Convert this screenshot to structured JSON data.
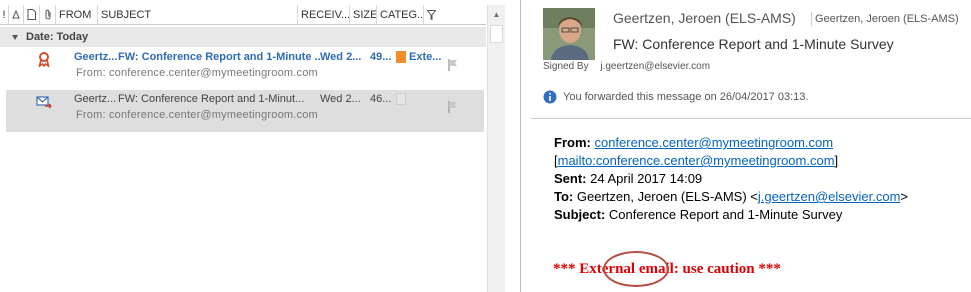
{
  "list_header": {
    "importance": "!",
    "reminder": "△",
    "type": "🗋",
    "attachment": "🖇",
    "from": "FROM",
    "subject": "SUBJECT",
    "received": "RECEIV...",
    "size": "SIZE",
    "categories": "CATEG...",
    "flag": "⚐"
  },
  "group": {
    "label": "Date: Today"
  },
  "messages": [
    {
      "from": "Geertz...",
      "subject": "FW: Conference Report and 1-Minute ...",
      "received": "Wed 2...",
      "size": "49...",
      "category": "Exte...",
      "category_color": "#f28c28",
      "preview": "From: conference.center@mymeetingroom.com",
      "icon": "award-icon"
    },
    {
      "from": "Geertz...",
      "subject": "FW: Conference Report and 1-Minut...",
      "received": "Wed 2...",
      "size": "46...",
      "category": "",
      "category_color": "#ffffff",
      "preview": "From: conference.center@mymeetingroom.com",
      "icon": "forwarded-icon"
    }
  ],
  "reading": {
    "sender_name": "Geertzen, Jeroen (ELS-AMS)",
    "sender_short": "Geertzen, Jeroen (ELS-AMS)",
    "subject": "FW: Conference Report and 1-Minute Survey",
    "signed_by_label": "Signed By",
    "signed_by_value": "j.geertzen@elsevier.com",
    "info": "You forwarded this message on 26/04/2017 03:13."
  },
  "body": {
    "from_label": "From:",
    "from_value": "conference.center@mymeetingroom.com",
    "mailto_prefix": "[",
    "mailto_link": "mailto:conference.center@mymeetingroom.com",
    "mailto_suffix": "]",
    "sent_label": "Sent:",
    "sent_value": "24 April 2017 14:09",
    "to_label": "To:",
    "to_value": "Geertzen, Jeroen (ELS-AMS) <",
    "to_link": "j.geertzen@elsevier.com",
    "to_suffix": ">",
    "subject_label": "Subject:",
    "subject_value": "Conference Report and 1-Minute Survey",
    "caution": "*** External email: use caution ***"
  },
  "colors": {
    "unread_blue": "#2e6cb5",
    "link_blue": "#0563c1",
    "caution_red": "#e00000",
    "selected_row": "#dedede"
  }
}
